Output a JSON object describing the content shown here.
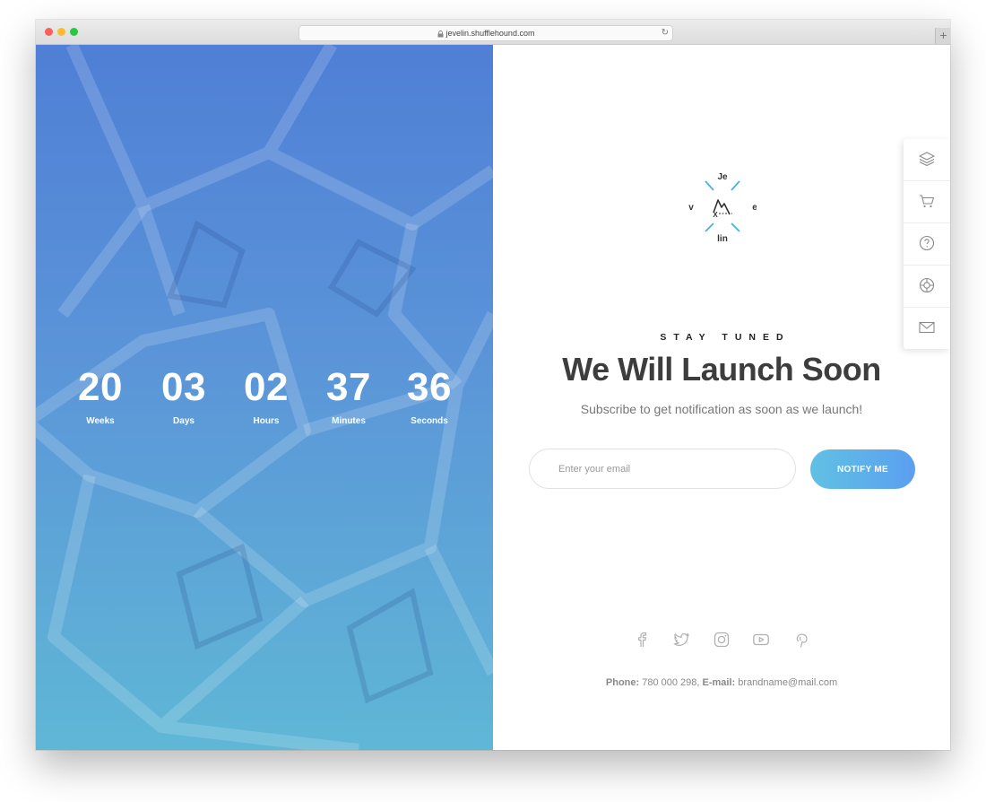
{
  "browser": {
    "url": "jevelin.shufflehound.com",
    "new_tab": "+"
  },
  "countdown": [
    {
      "value": "20",
      "label": "Weeks"
    },
    {
      "value": "03",
      "label": "Days"
    },
    {
      "value": "02",
      "label": "Hours"
    },
    {
      "value": "37",
      "label": "Minutes"
    },
    {
      "value": "36",
      "label": "Seconds"
    }
  ],
  "logo": {
    "top": "Je",
    "left": "v",
    "right": "e",
    "bottom": "lin",
    "mark": "X"
  },
  "hero": {
    "eyebrow": "STAY TUNED",
    "title": "We Will Launch Soon",
    "subtitle": "Subscribe to get notification as soon as we launch!"
  },
  "form": {
    "email_placeholder": "Enter your email",
    "email_value": "",
    "button_label": "NOTIFY ME"
  },
  "social_icons": [
    "facebook-icon",
    "twitter-icon",
    "instagram-icon",
    "youtube-icon",
    "pinterest-icon"
  ],
  "contact": {
    "phone_label": "Phone:",
    "phone": "780 000 298,",
    "email_label": "E-mail:",
    "email": "brandname@mail.com"
  },
  "dock_icons": [
    "layers-icon",
    "cart-icon",
    "help-icon",
    "support-icon",
    "mail-icon"
  ],
  "colors": {
    "gradient_top": "#4f7fd6",
    "gradient_bottom": "#5fb7d6",
    "button_start": "#60c1e4",
    "button_end": "#5b9ff0",
    "logo_accent": "#45b3e3"
  }
}
